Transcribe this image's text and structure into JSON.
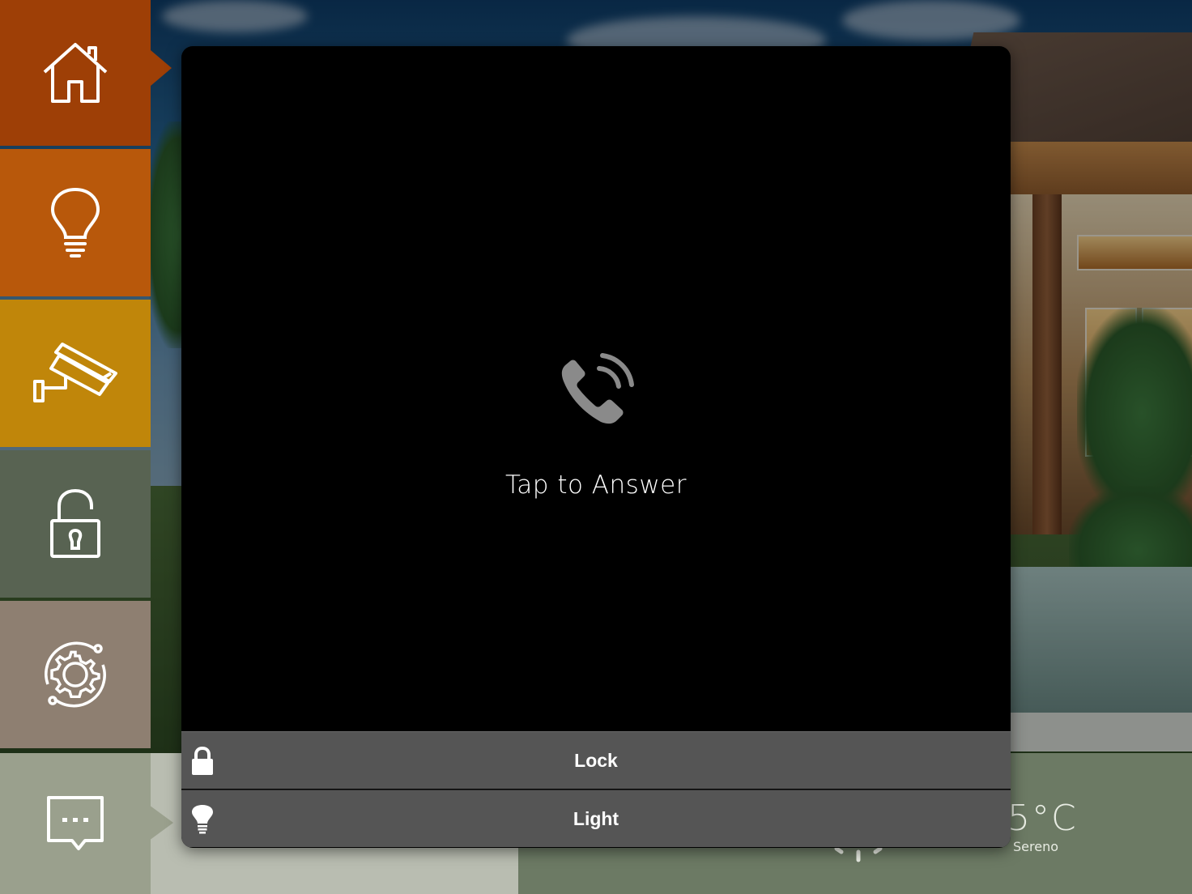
{
  "sidebar": {
    "items": [
      {
        "id": "home",
        "icon": "home-icon",
        "color": "#9e3f06",
        "active": true
      },
      {
        "id": "lights",
        "icon": "lightbulb-icon",
        "color": "#b8580b"
      },
      {
        "id": "cameras",
        "icon": "security-camera-icon",
        "color": "#c0860a"
      },
      {
        "id": "locks",
        "icon": "unlocked-padlock-icon",
        "color": "#586352"
      },
      {
        "id": "settings",
        "icon": "gear-icon",
        "color": "#8e7f71"
      },
      {
        "id": "messages",
        "icon": "chat-bubble-icon",
        "color": "#9aa08d"
      }
    ]
  },
  "intercom": {
    "call_icon": "phone-ringing-icon",
    "prompt": "Tap to Answer",
    "actions": [
      {
        "label": "Lock",
        "icon": "padlock-icon"
      },
      {
        "label": "Light",
        "icon": "lightbulb-icon"
      }
    ]
  },
  "weather": {
    "temperature": "5°C",
    "condition": "Sereno",
    "icon": "sun-icon"
  }
}
